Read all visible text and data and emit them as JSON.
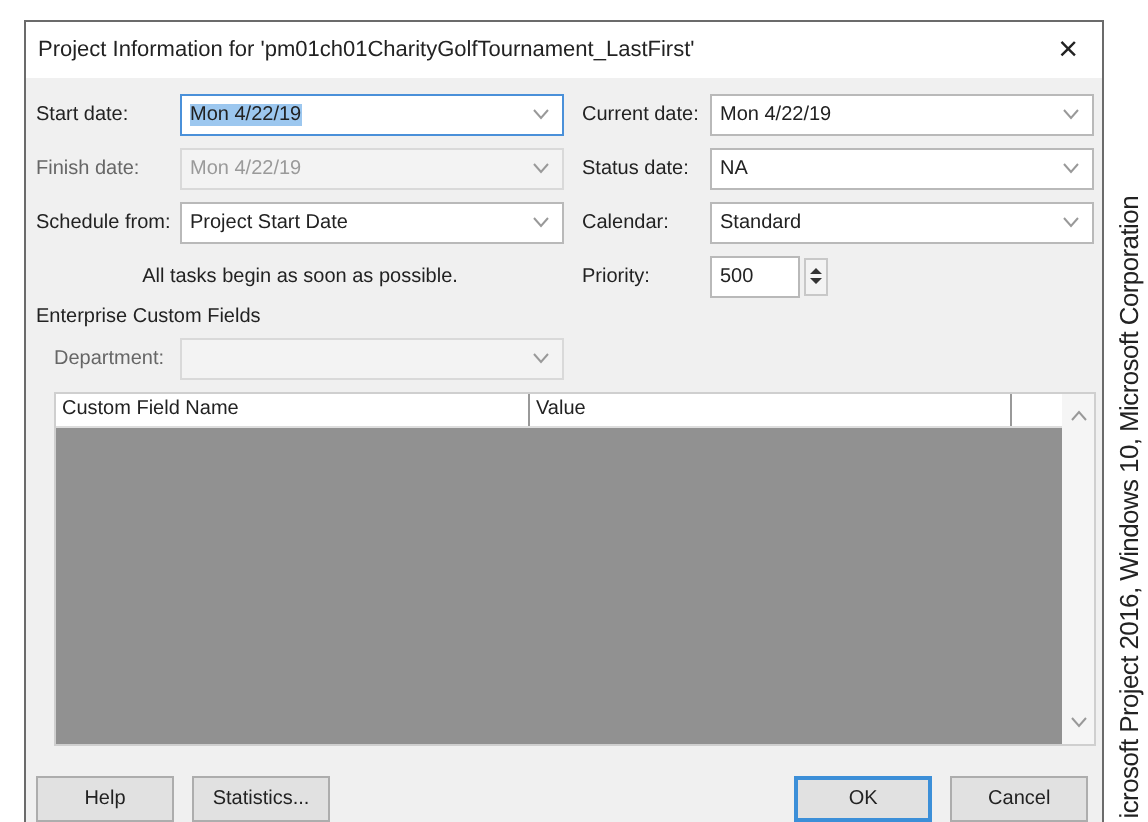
{
  "window": {
    "title": "Project Information for 'pm01ch01CharityGolfTournament_LastFirst'",
    "close": "×"
  },
  "left_fields": [
    {
      "label": "Start date:",
      "value": "Mon 4/22/19",
      "kind": "combo",
      "disabled": false,
      "highlighted": true
    },
    {
      "label": "Finish date:",
      "value": "Mon 4/22/19",
      "kind": "combo",
      "disabled": true,
      "highlighted": false
    },
    {
      "label": "Schedule from:",
      "value": "Project Start Date",
      "kind": "combo",
      "disabled": false,
      "highlighted": false
    }
  ],
  "note": "All tasks begin as soon as possible.",
  "right_fields": [
    {
      "label": "Current date:",
      "value": "Mon 4/22/19",
      "kind": "combo",
      "disabled": false,
      "highlighted": false
    },
    {
      "label": "Status date:",
      "value": "NA",
      "kind": "combo",
      "disabled": false,
      "highlighted": false
    },
    {
      "label": "Calendar:",
      "value": "Standard",
      "kind": "combo",
      "disabled": false,
      "highlighted": false
    },
    {
      "label": "Priority:",
      "value": "500",
      "kind": "spin",
      "disabled": false,
      "highlighted": false
    }
  ],
  "enterprise": {
    "title": "Enterprise Custom Fields",
    "department": {
      "label": "Department:",
      "disabled": true
    },
    "table": {
      "columns": [
        "Custom Field Name",
        "Value"
      ]
    }
  },
  "buttons": [
    {
      "label": "Help",
      "default": false
    },
    {
      "label": "Statistics...",
      "default": false
    },
    {
      "label": "OK",
      "default": true
    },
    {
      "label": "Cancel",
      "default": false
    }
  ],
  "credit": "icrosoft Project 2016, Windows 10, Microsoft Corporation"
}
